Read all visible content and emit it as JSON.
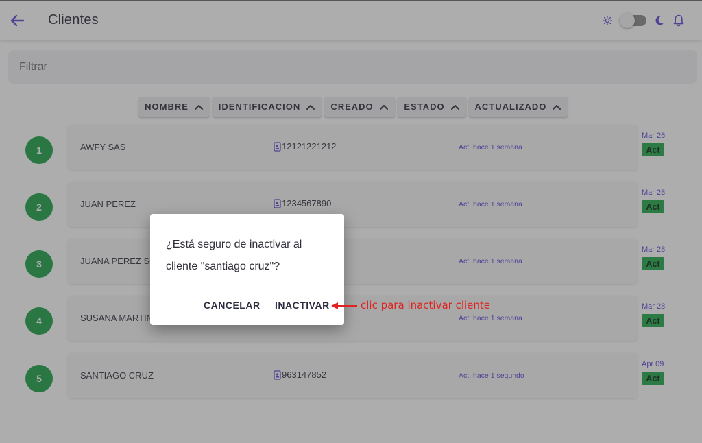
{
  "header": {
    "title": "Clientes"
  },
  "filter": {
    "placeholder": "Filtrar"
  },
  "sort": [
    {
      "label": "NOMBRE"
    },
    {
      "label": "IDENTIFICACION"
    },
    {
      "label": "CREADO"
    },
    {
      "label": "ESTADO"
    },
    {
      "label": "ACTUALIZADO"
    }
  ],
  "clients": [
    {
      "index": "1",
      "name": "AWFY SAS",
      "identification": "12121221212",
      "updated": "Act. hace 1 semana",
      "date": "Mar 26",
      "status": "Act"
    },
    {
      "index": "2",
      "name": "JUAN PEREZ",
      "identification": "1234567890",
      "updated": "Act. hace 1 semana",
      "date": "Mar 28",
      "status": "Act"
    },
    {
      "index": "3",
      "name": "JUANA PEREZ SO",
      "identification": "",
      "updated": "Act. hace 1 semana",
      "date": "Mar 28",
      "status": "Act"
    },
    {
      "index": "4",
      "name": "SUSANA MARTIN",
      "identification": "",
      "updated": "Act. hace 1 semana",
      "date": "Mar 28",
      "status": "Act"
    },
    {
      "index": "5",
      "name": "SANTIAGO CRUZ",
      "identification": "963147852",
      "updated": "Act. hace 1 segundo",
      "date": "Apr 09",
      "status": "Act"
    }
  ],
  "dialog": {
    "message": "¿Está seguro de inactivar al cliente \"santiago cruz\"?",
    "cancel_label": "CANCELAR",
    "confirm_label": "INACTIVAR"
  },
  "annotation": {
    "text": "clic para inactivar cliente"
  },
  "colors": {
    "accent": "#5b4bd6",
    "badge": "#1fa34a",
    "status": "#21a84a",
    "annotation": "#e0231f"
  },
  "icons": {
    "back": "arrow-left-icon",
    "sun": "sun-icon",
    "moon": "moon-icon",
    "bell": "bell-icon",
    "sort": "chevron-up-icon",
    "id": "id-card-icon"
  }
}
